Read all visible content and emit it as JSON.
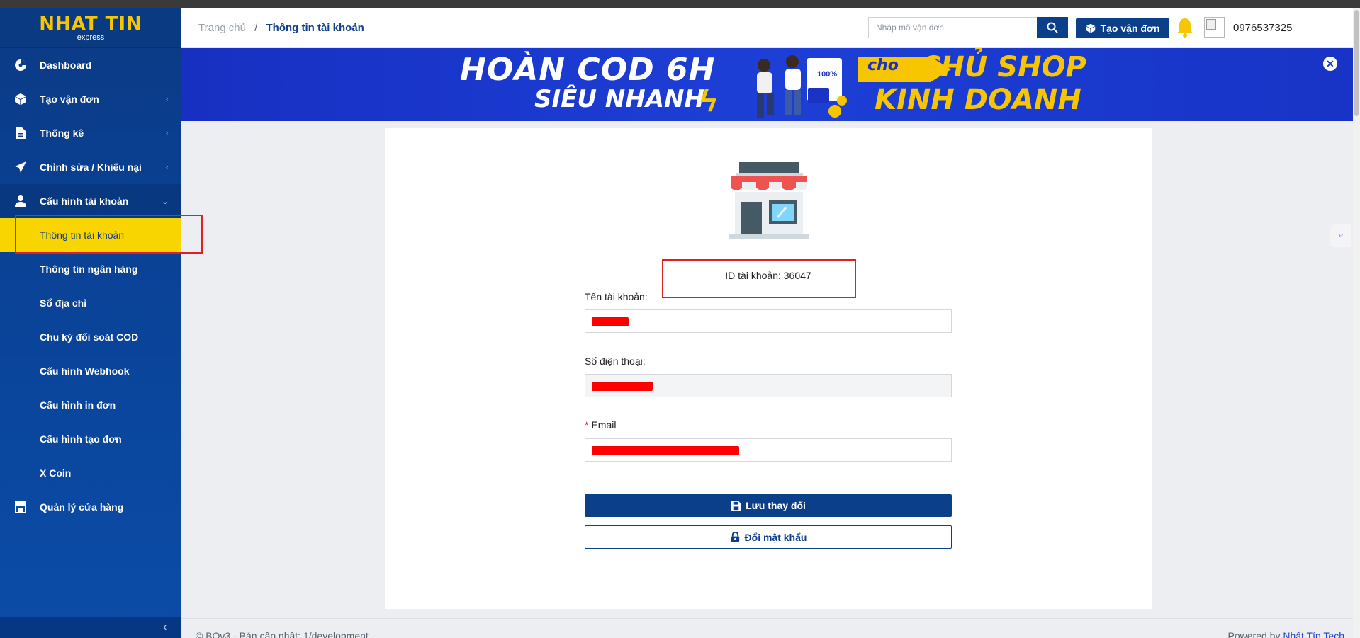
{
  "logo": {
    "main": "NHAT TIN",
    "sub": "express"
  },
  "sidebar": {
    "items": [
      {
        "label": "Dashboard",
        "icon": "dashboard-icon"
      },
      {
        "label": "Tạo vận đơn",
        "icon": "box-icon"
      },
      {
        "label": "Thống kê",
        "icon": "document-icon"
      },
      {
        "label": "Chỉnh sửa / Khiếu nại",
        "icon": "paper-plane-icon"
      },
      {
        "label": "Cấu hình tài khoản",
        "icon": "user-icon"
      }
    ],
    "subitems": [
      "Thông tin tài khoản",
      "Thông tin ngân hàng",
      "Sổ địa chỉ",
      "Chu kỳ đối soát COD",
      "Cấu hình Webhook",
      "Cấu hình in đơn",
      "Cấu hình tạo đơn",
      "X Coin"
    ],
    "store_item": {
      "label": "Quản lý cửa hàng",
      "icon": "store-icon"
    },
    "collapse_glyph": "‹"
  },
  "header": {
    "breadcrumb_home": "Trang chủ",
    "breadcrumb_sep": "/",
    "breadcrumb_current": "Thông tin tài khoản",
    "search_placeholder": "Nhập mã vận đơn",
    "create_label": "Tạo vận đơn",
    "phone": "0976537325"
  },
  "banner": {
    "line1": "HOÀN COD 6H",
    "line2": "SIÊU NHANH",
    "cho": "cho",
    "yellow1": "CHỦ SHOP",
    "yellow2": "KINH DOANH",
    "close": "✕"
  },
  "account": {
    "id_text": "ID tài khoản: 36047",
    "name_label": "Tên tài khoản:",
    "phone_label": "Số điện thoại:",
    "email_required": "*",
    "email_label": "Email",
    "save_label": "Lưu thay đổi",
    "password_label": "Đổi mật khẩu"
  },
  "footer": {
    "left": "© BOv3 - Bản cập nhật: 1/development",
    "powered": "Powered by",
    "company": "Nhất Tín Tech"
  },
  "colors": {
    "primary": "#0b3f8a",
    "accent": "#f9d500",
    "banner": "#1d3fd6",
    "highlight": "#e02020"
  }
}
